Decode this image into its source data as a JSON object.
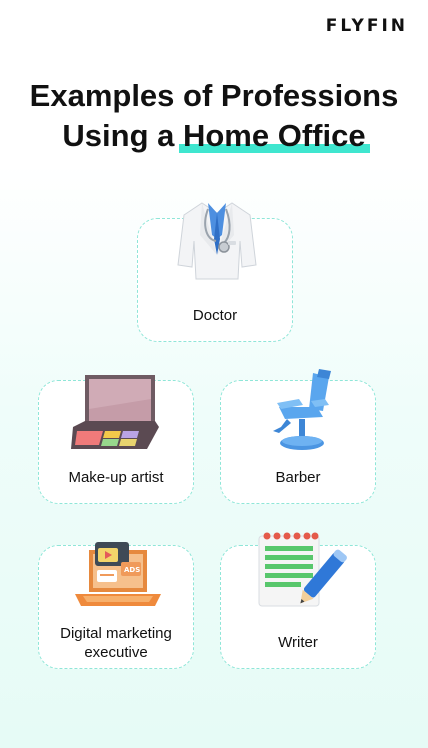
{
  "brand": {
    "logo_text": "FLYFIN"
  },
  "heading": {
    "line1": "Examples of Professions",
    "line2_prefix": "Using a ",
    "line2_highlight": "Home Office"
  },
  "professions": [
    {
      "label": "Doctor",
      "icon": "doctor-coat-icon"
    },
    {
      "label": "Make-up artist",
      "icon": "makeup-palette-icon"
    },
    {
      "label": "Barber",
      "icon": "barber-chair-icon"
    },
    {
      "label": "Digital marketing executive",
      "icon": "laptop-marketing-icon"
    },
    {
      "label": "Writer",
      "icon": "notepad-pencil-icon"
    }
  ],
  "colors": {
    "highlight": "#3fe6cf",
    "card_border": "#8fe6d8",
    "background_tint": "#e6fbf6"
  }
}
